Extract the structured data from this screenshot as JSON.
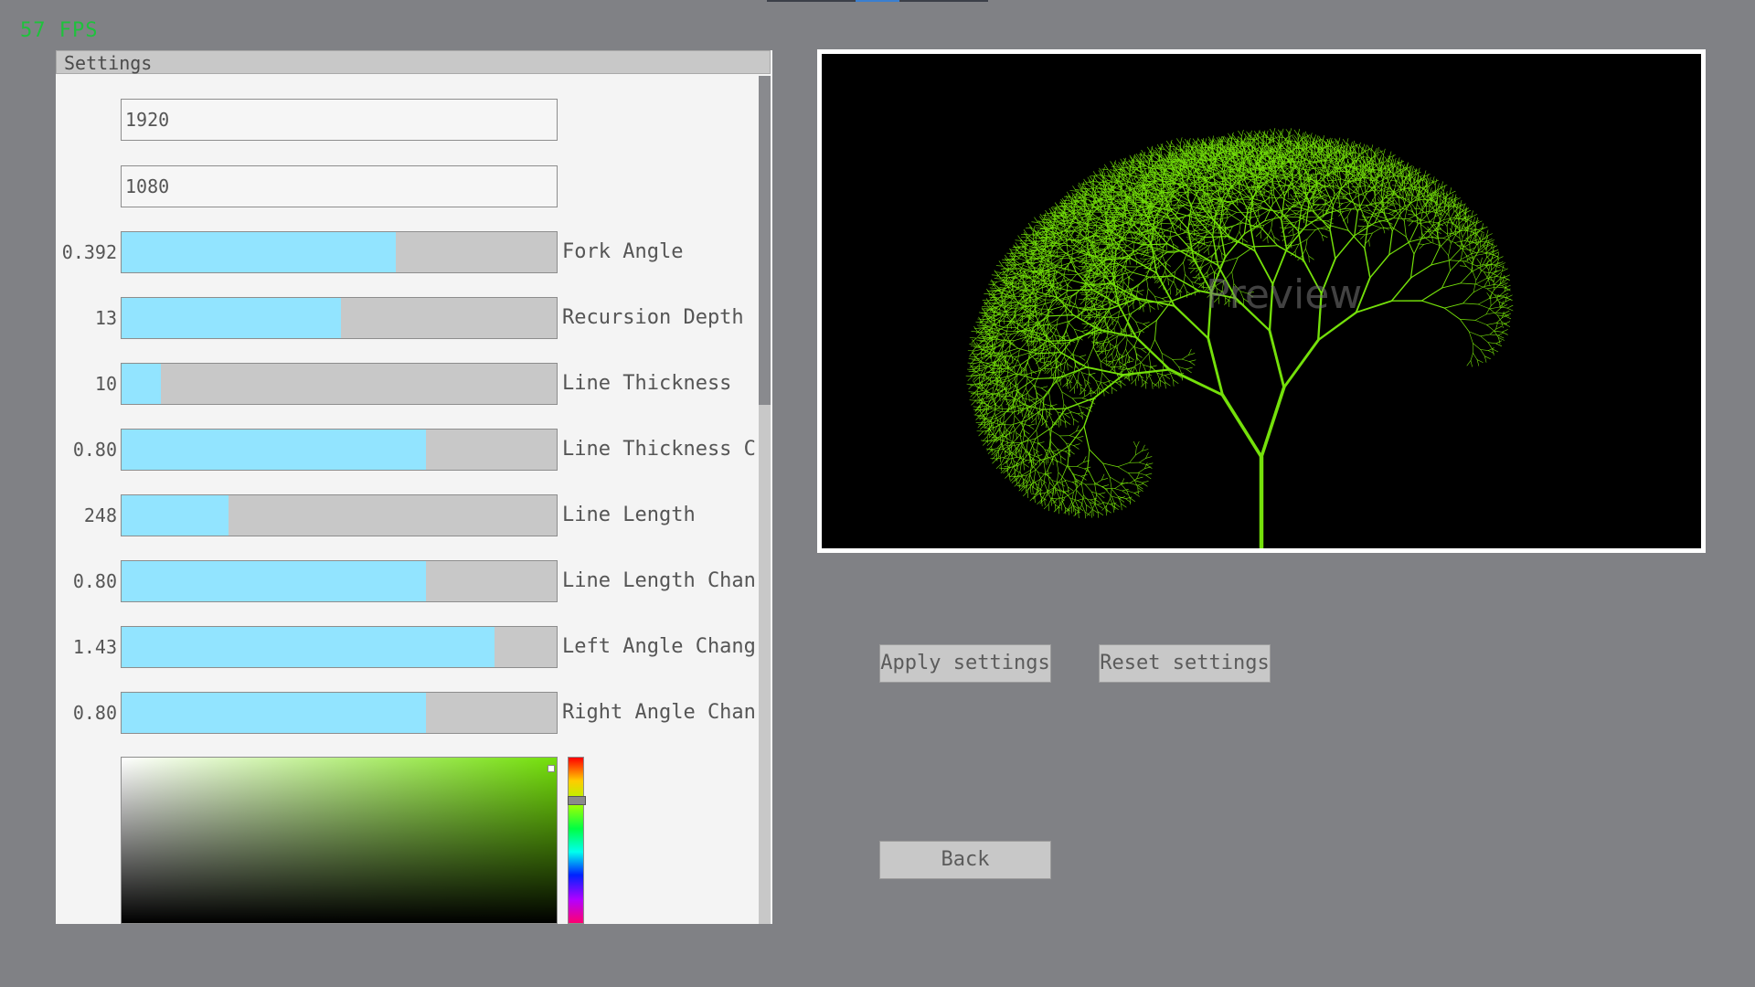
{
  "fps": "57 FPS",
  "settings": {
    "title": "Settings",
    "width_value": "1920",
    "height_value": "1080",
    "sliders": [
      {
        "value": "0.392",
        "label": "Fork Angle",
        "fill": 0.63
      },
      {
        "value": "13",
        "label": "Recursion Depth",
        "fill": 0.505
      },
      {
        "value": "10",
        "label": "Line Thickness",
        "fill": 0.09
      },
      {
        "value": "0.80",
        "label": "Line Thickness Cha",
        "fill": 0.7
      },
      {
        "value": "248",
        "label": "Line Length",
        "fill": 0.245
      },
      {
        "value": "0.80",
        "label": "Line Length Chang",
        "fill": 0.7
      },
      {
        "value": "1.43",
        "label": "Left Angle Change",
        "fill": 0.857
      },
      {
        "value": "0.80",
        "label": "Right Angle Chang",
        "fill": 0.7
      }
    ],
    "color": {
      "hex": "#74e00a"
    }
  },
  "preview": {
    "label": "Preview",
    "tree_color": "#74e00a",
    "background": "#000000"
  },
  "buttons": {
    "apply": "Apply settings",
    "reset": "Reset settings",
    "back": "Back"
  }
}
